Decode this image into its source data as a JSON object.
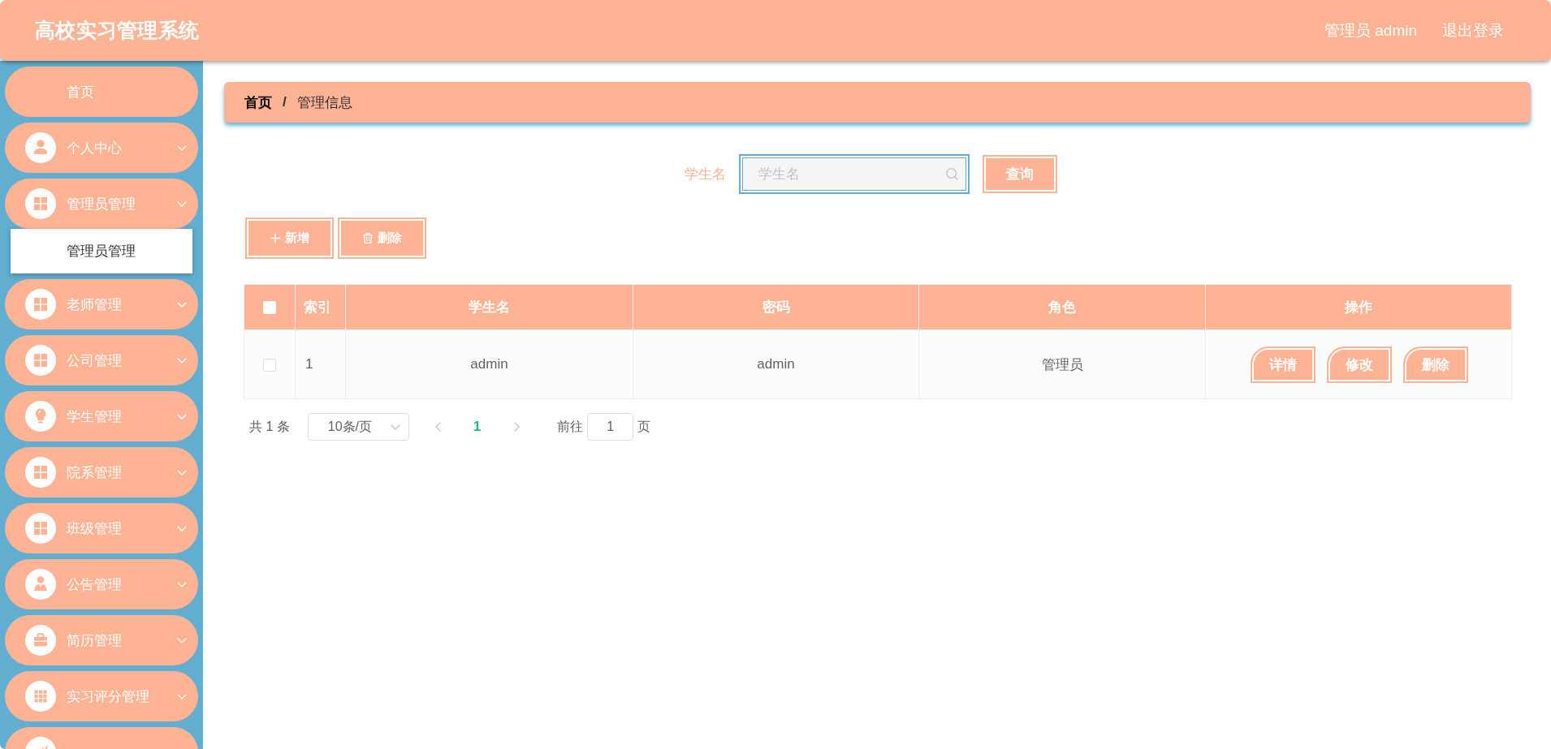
{
  "header": {
    "title": "高校实习管理系统",
    "user": "管理员 admin",
    "logout": "退出登录"
  },
  "sidebar": {
    "items": [
      {
        "kind": "link",
        "label": "首页"
      },
      {
        "kind": "submenu",
        "label": "个人中心"
      },
      {
        "kind": "submenu",
        "label": "管理员管理",
        "children": [
          {
            "label": "管理员管理"
          }
        ]
      },
      {
        "kind": "submenu",
        "label": "老师管理"
      },
      {
        "kind": "submenu",
        "label": "公司管理"
      },
      {
        "kind": "submenu",
        "label": "学生管理"
      },
      {
        "kind": "submenu",
        "label": "院系管理"
      },
      {
        "kind": "submenu",
        "label": "班级管理"
      },
      {
        "kind": "submenu",
        "label": "公告管理"
      },
      {
        "kind": "submenu",
        "label": "简历管理"
      },
      {
        "kind": "submenu",
        "label": "实习评分管理"
      },
      {
        "kind": "submenu"
      }
    ]
  },
  "breadcrumb": {
    "items": [
      "首页",
      "管理信息"
    ],
    "separator": "/"
  },
  "search": {
    "label": "学生名",
    "placeholder": "学生名",
    "button": "查询"
  },
  "toolbar": {
    "buttons": [
      "新增",
      "删除"
    ]
  },
  "table": {
    "select_all": {
      "checked": false
    },
    "columns": [
      "索引",
      "学生名",
      "密码",
      "角色",
      "操作"
    ],
    "rows": [
      {
        "selected": false,
        "cells": [
          "1",
          "admin",
          "admin",
          "管理员"
        ],
        "actions": [
          "详情",
          "修改",
          "删除"
        ]
      }
    ]
  },
  "pagination": {
    "total": "共 1 条",
    "page_size": "10条/页",
    "prev": {
      "disabled": true
    },
    "pages": [
      {
        "label": "1",
        "selected": true
      }
    ],
    "next": {
      "disabled": true
    },
    "goto_label": "前往",
    "goto_value": "1",
    "goto_suffix": "页"
  }
}
